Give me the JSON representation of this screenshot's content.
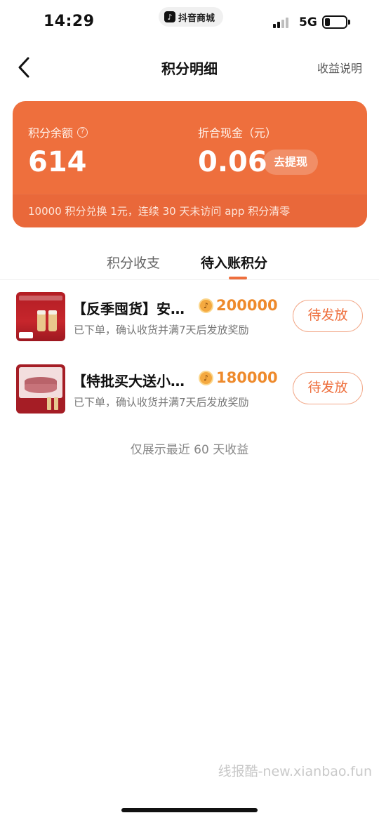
{
  "status_bar": {
    "time": "14:29",
    "app_pill_label": "抖音商城",
    "network": "5G",
    "battery_level": 0.25
  },
  "nav": {
    "title": "积分明细",
    "right_label": "收益说明"
  },
  "balance": {
    "points_label": "积分余额",
    "points_value": "614",
    "cash_label": "折合现金（元）",
    "cash_value": "0.06",
    "withdraw_label": "去提现",
    "footer_note": "10000 积分兑换 1元，连续 30 天未访问 app 积分清零"
  },
  "tabs": [
    {
      "label": "积分收支",
      "active": false
    },
    {
      "label": "待入账积分",
      "active": true
    }
  ],
  "items": [
    {
      "title": "【反季囤货】安…",
      "points": "200000",
      "desc": "已下单，确认收货并满7天后发放奖励",
      "status": "待发放"
    },
    {
      "title": "【特批买大送小…",
      "points": "180000",
      "desc": "已下单，确认收货并满7天后发放奖励",
      "status": "待发放"
    }
  ],
  "footer_note": "仅展示最近 60 天收益",
  "watermark": "线报酷-new.xianbao.fun",
  "colors": {
    "accent": "#ee6f3d",
    "points": "#ee8a2c"
  }
}
